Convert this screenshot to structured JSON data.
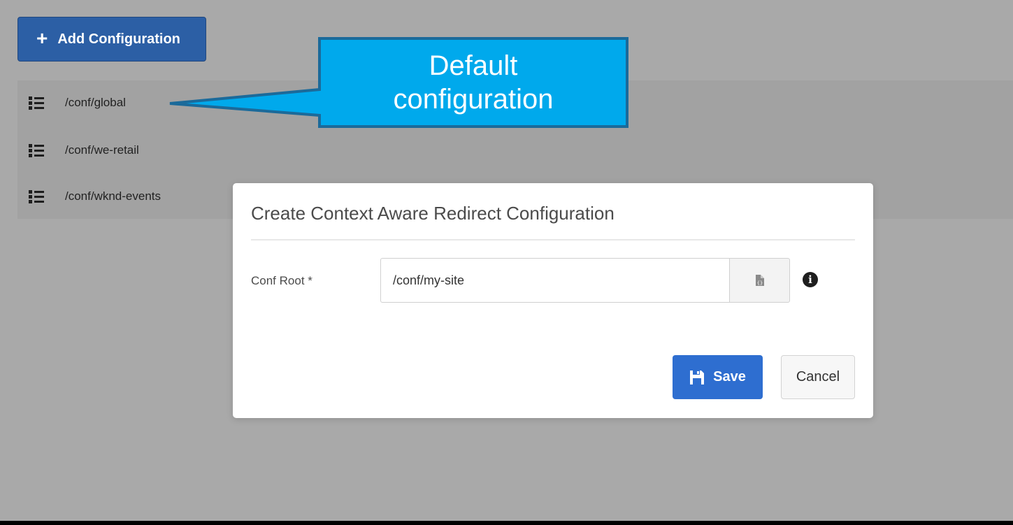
{
  "toolbar": {
    "add_label": "Add Configuration",
    "add_icon": "plus-icon"
  },
  "configurations": [
    {
      "path": "/conf/global",
      "icon": "list-icon"
    },
    {
      "path": "/conf/we-retail",
      "icon": "list-icon"
    },
    {
      "path": "/conf/wknd-events",
      "icon": "list-icon"
    }
  ],
  "callout": {
    "line1": "Default",
    "line2": "configuration"
  },
  "dialog": {
    "title": "Create Context Aware Redirect Configuration",
    "field_label": "Conf Root *",
    "field_value": "/conf/my-site",
    "browse_icon": "file-browse-icon",
    "info_icon": "info-icon",
    "save_label": "Save",
    "save_icon": "floppy-disk-icon",
    "cancel_label": "Cancel"
  },
  "colors": {
    "background": "#a9a9a9",
    "primary_button": "#2e6ed0",
    "add_button": "#2c5fa5",
    "callout": "#00a9ec"
  }
}
